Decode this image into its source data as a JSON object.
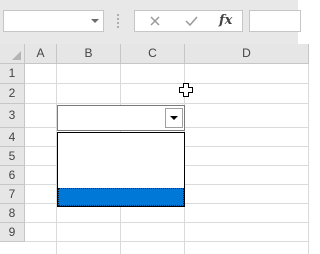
{
  "formula_bar": {
    "name_box": {
      "value": ""
    },
    "cancel_icon": "close-icon",
    "enter_icon": "check-icon",
    "function_label": "fx",
    "formula": {
      "value": ""
    }
  },
  "sheet": {
    "columns": [
      "A",
      "B",
      "C",
      "D"
    ],
    "rows": [
      "1",
      "2",
      "3",
      "4",
      "5",
      "6",
      "7",
      "8",
      "9"
    ]
  },
  "dropdown": {
    "cell": "B3",
    "selected_value": "",
    "options": [
      "",
      "",
      "",
      ""
    ],
    "highlighted_index": 3,
    "highlight_color": "#0078d7"
  },
  "cursor": "cell-select-cross-icon"
}
